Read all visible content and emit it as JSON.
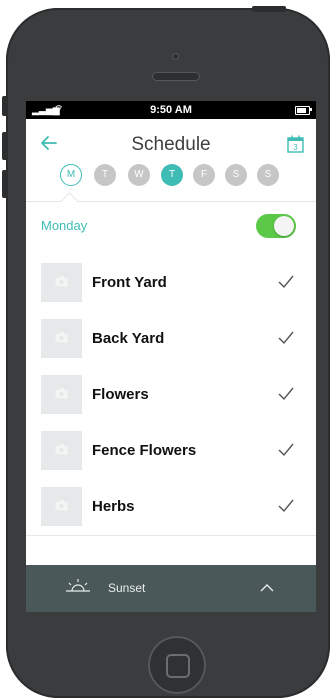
{
  "status_bar": {
    "time": "9:50 AM"
  },
  "header": {
    "title": "Schedule"
  },
  "days": [
    {
      "letter": "M",
      "state": "selected"
    },
    {
      "letter": "T",
      "state": "off"
    },
    {
      "letter": "W",
      "state": "off"
    },
    {
      "letter": "T",
      "state": "active"
    },
    {
      "letter": "F",
      "state": "off"
    },
    {
      "letter": "S",
      "state": "off"
    },
    {
      "letter": "S",
      "state": "off"
    }
  ],
  "section": {
    "label": "Monday",
    "toggle_on": true
  },
  "zones": [
    {
      "name": "Front Yard",
      "checked": true
    },
    {
      "name": "Back Yard",
      "checked": true
    },
    {
      "name": "Flowers",
      "checked": true
    },
    {
      "name": "Fence Flowers",
      "checked": true
    },
    {
      "name": "Herbs",
      "checked": true
    }
  ],
  "footer": {
    "label": "Sunset"
  },
  "colors": {
    "accent": "#3fbcb4",
    "toggle": "#5bc947",
    "footer_bg": "#4b5859",
    "phone_body": "#3a3c3d"
  },
  "icons": {
    "back": "arrow-left-icon",
    "calendar": "calendar-icon",
    "thumbnail": "camera-icon",
    "check": "check-icon",
    "sunset": "sunset-icon",
    "expand": "chevron-up-icon"
  }
}
